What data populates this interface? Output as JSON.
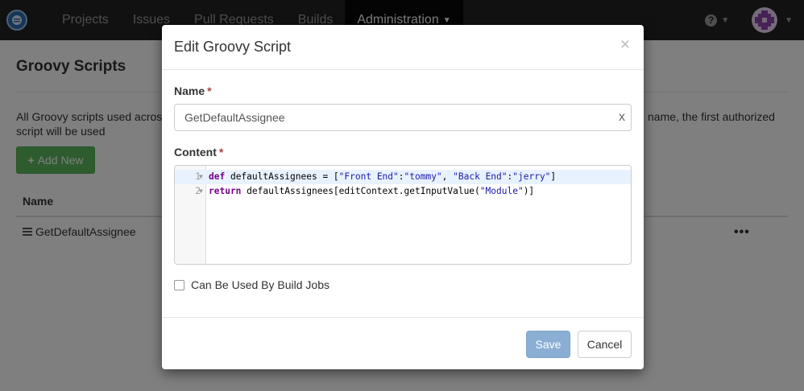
{
  "navbar": {
    "logo_icon": "onedev-logo-icon",
    "items": [
      {
        "label": "Projects"
      },
      {
        "label": "Issues"
      },
      {
        "label": "Pull Requests"
      },
      {
        "label": "Builds"
      }
    ],
    "active_item": {
      "label": "Administration"
    },
    "help_icon": "question-icon",
    "avatar_icon": "user-avatar-icon"
  },
  "page": {
    "title": "Groovy Scripts",
    "description_left": "All Groovy scripts used across th",
    "description_right": "name, the first authorized",
    "description_line2": "script will be used",
    "add_new_label": "Add New",
    "column_name": "Name",
    "rows": [
      {
        "name": "GetDefaultAssignee"
      }
    ],
    "row_menu": "•••"
  },
  "modal": {
    "title": "Edit Groovy Script",
    "close": "×",
    "name_label": "Name",
    "required_mark": "*",
    "name_value": "GetDefaultAssignee",
    "clear_label": "x",
    "content_label": "Content",
    "code_lines": [
      {
        "number": "1",
        "text": "def defaultAssignees = [\"Front End\":\"tommy\", \"Back End\":\"jerry\"]"
      },
      {
        "number": "2",
        "text": "return defaultAssignees[editContext.getInputValue(\"Module\")]"
      }
    ],
    "checkbox_label": "Can Be Used By Build Jobs",
    "checkbox_checked": false,
    "save_label": "Save",
    "cancel_label": "Cancel"
  },
  "colors": {
    "navbar_bg": "#222222",
    "add_new_bg": "#5cb85c",
    "save_bg": "#8bafd4",
    "required": "#a94442"
  }
}
